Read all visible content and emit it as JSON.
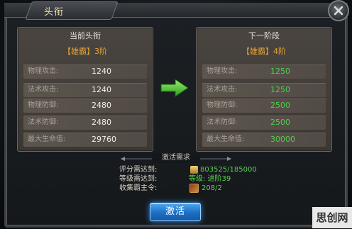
{
  "window": {
    "title": "头衔"
  },
  "current": {
    "heading": "当前头衔",
    "rank": {
      "open": "【",
      "name": "雄霸",
      "close": "】",
      "level": "3阶"
    },
    "stats": [
      {
        "label": "物理攻击:",
        "value": "1240"
      },
      {
        "label": "法术攻击:",
        "value": "1240"
      },
      {
        "label": "物理防御:",
        "value": "2480"
      },
      {
        "label": "法术防御:",
        "value": "2480"
      },
      {
        "label": "最大生命值:",
        "value": "29760"
      }
    ]
  },
  "next": {
    "heading": "下一阶段",
    "rank": {
      "open": "【",
      "name": "雄霸",
      "close": "】",
      "level": "4阶"
    },
    "stats": [
      {
        "label": "物理攻击:",
        "value": "1250"
      },
      {
        "label": "法术攻击:",
        "value": "1250"
      },
      {
        "label": "物理防御:",
        "value": "2500"
      },
      {
        "label": "法术防御:",
        "value": "2500"
      },
      {
        "label": "最大生命值:",
        "value": "30000"
      }
    ]
  },
  "requirements": {
    "title": "激活需求",
    "score_label": "评分需达到:",
    "score_value": "803525/185000",
    "level_label": "等级需达到:",
    "level_value": "等级: 进阶39",
    "item_label": "收集霸主令:",
    "item_value": "208/2"
  },
  "activate_label": "激活",
  "watermark": "思创网",
  "colors": {
    "accent_green": "#4fd04c",
    "rank_orange": "#e6a43a",
    "button_blue": "#1d6fc4"
  }
}
